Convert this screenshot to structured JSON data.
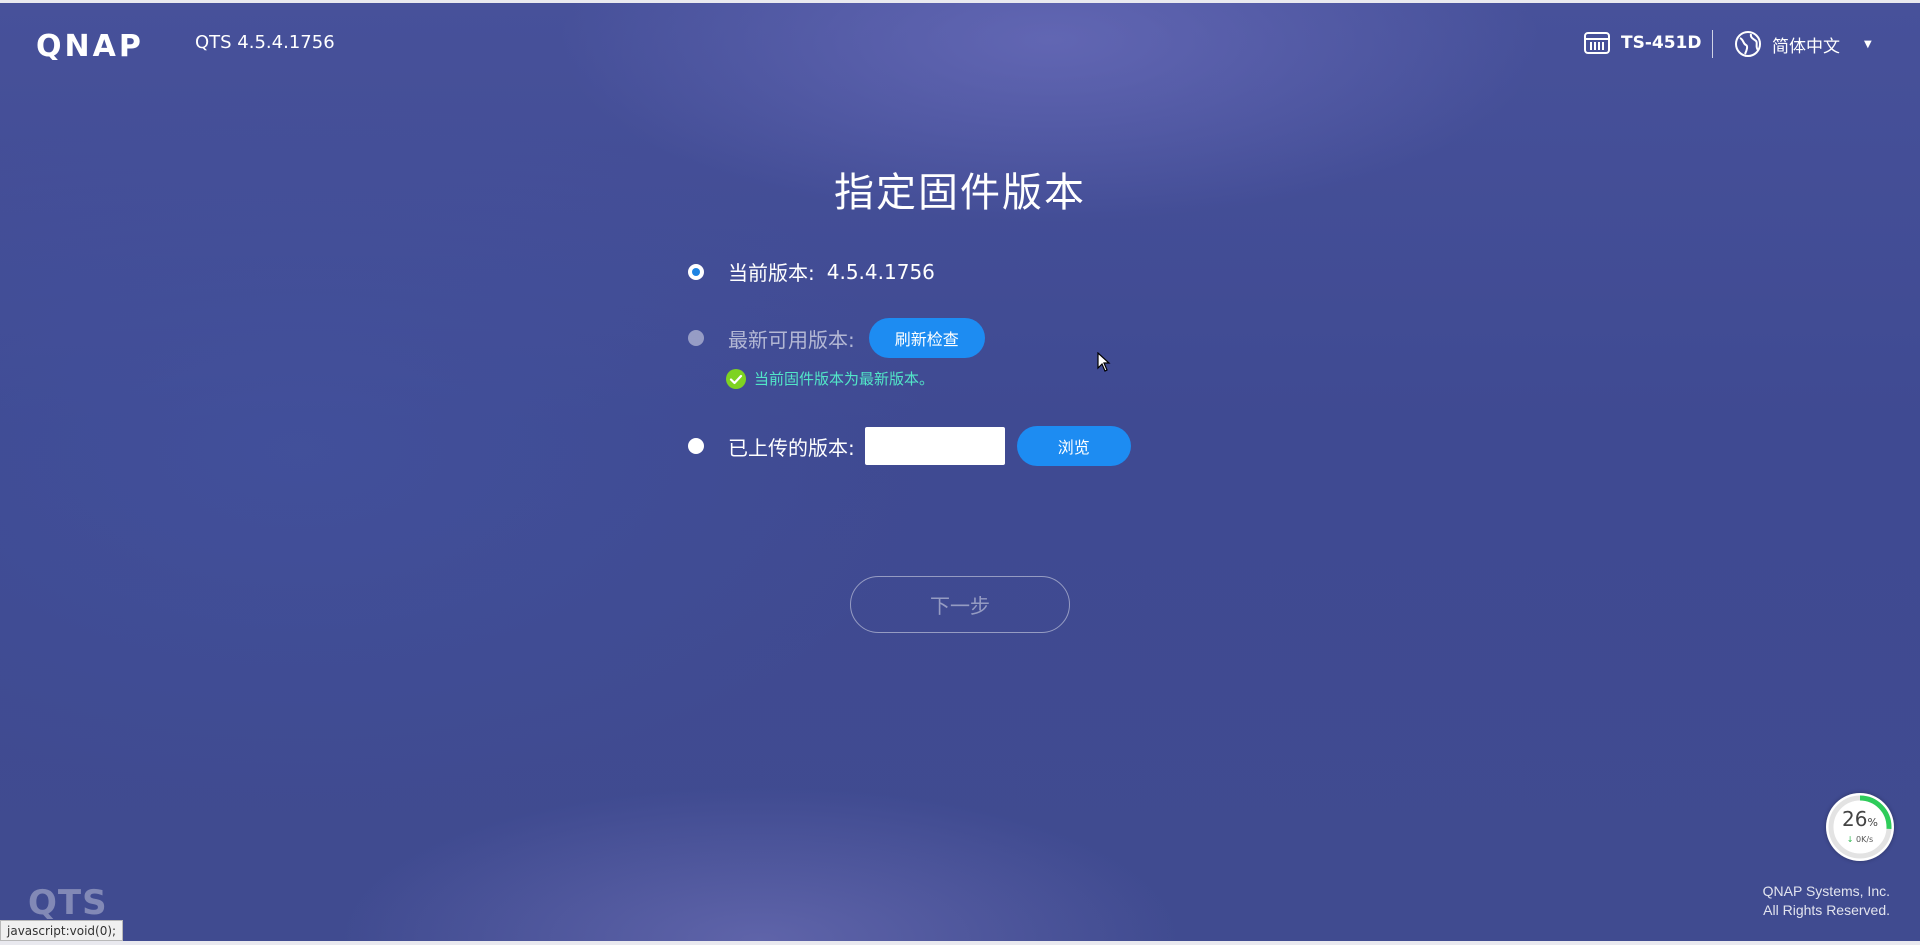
{
  "header": {
    "brand": "QNAP",
    "version": "QTS 4.5.4.1756",
    "device_name": "TS-451D",
    "language": "简体中文"
  },
  "main": {
    "title": "指定固件版本",
    "options": [
      {
        "label": "当前版本:",
        "value": "4.5.4.1756",
        "state": "checked"
      },
      {
        "label": "最新可用版本:",
        "button": "刷新检查",
        "state": "disabled"
      },
      {
        "label": "已上传的版本:",
        "input_value": "",
        "button": "浏览",
        "state": "unchecked"
      }
    ],
    "status_message": "当前固件版本为最新版本。",
    "next_button": "下一步"
  },
  "footer": {
    "watermark": "QTS",
    "status_bar": "javascript:void(0);",
    "copyright_line1": "QNAP Systems, Inc.",
    "copyright_line2": "All Rights Reserved.",
    "speed_percent": "26",
    "speed_unit": "%",
    "speed_rate": "0K/s",
    "speed_progress": 0.26
  },
  "colors": {
    "accent": "#1d8cf2",
    "success": "#7ed321",
    "status_text": "#52e6c8"
  },
  "icons": {
    "device": "nas-device-icon",
    "language": "globe-icon",
    "status": "check-circle-icon",
    "speed": "download-arrow-icon"
  }
}
